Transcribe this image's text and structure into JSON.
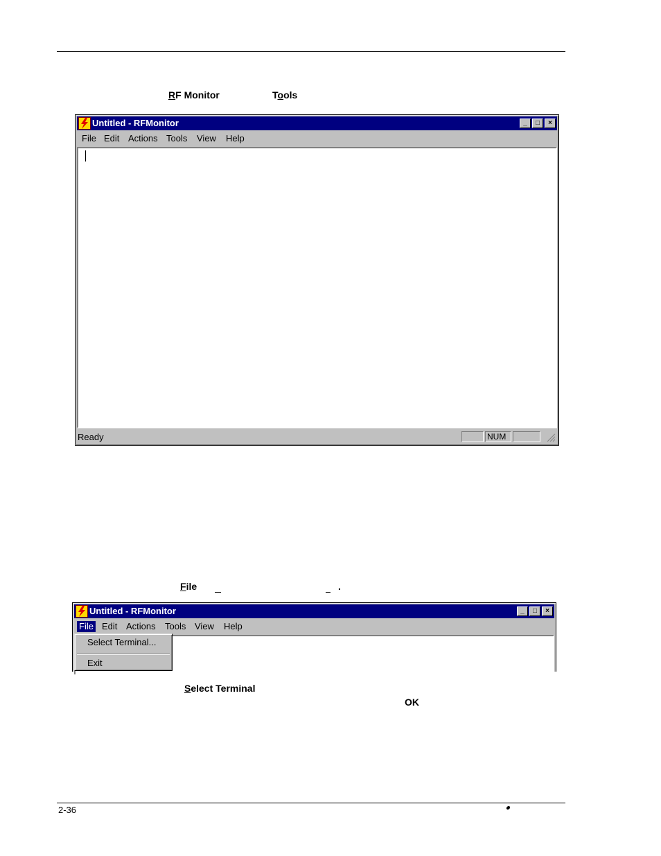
{
  "doc": {
    "line1": {
      "rf_monitor": "RF Monitor",
      "tools": "Tools"
    },
    "line2": {
      "file": "File",
      "period": "."
    },
    "line3": {
      "select_terminal": "Select Terminal",
      "ok": "OK"
    },
    "page_number": "2-36"
  },
  "window": {
    "title": "Untitled - RFMonitor",
    "menu": [
      "File",
      "Edit",
      "Actions",
      "Tools",
      "View",
      "Help"
    ],
    "status": {
      "text": "Ready",
      "num": "NUM"
    },
    "file_menu": {
      "select_terminal": "Select Terminal...",
      "exit": "Exit"
    }
  },
  "colors": {
    "titlebar": "#000080",
    "face": "#c0c0c0",
    "icon": "#ffd800"
  }
}
